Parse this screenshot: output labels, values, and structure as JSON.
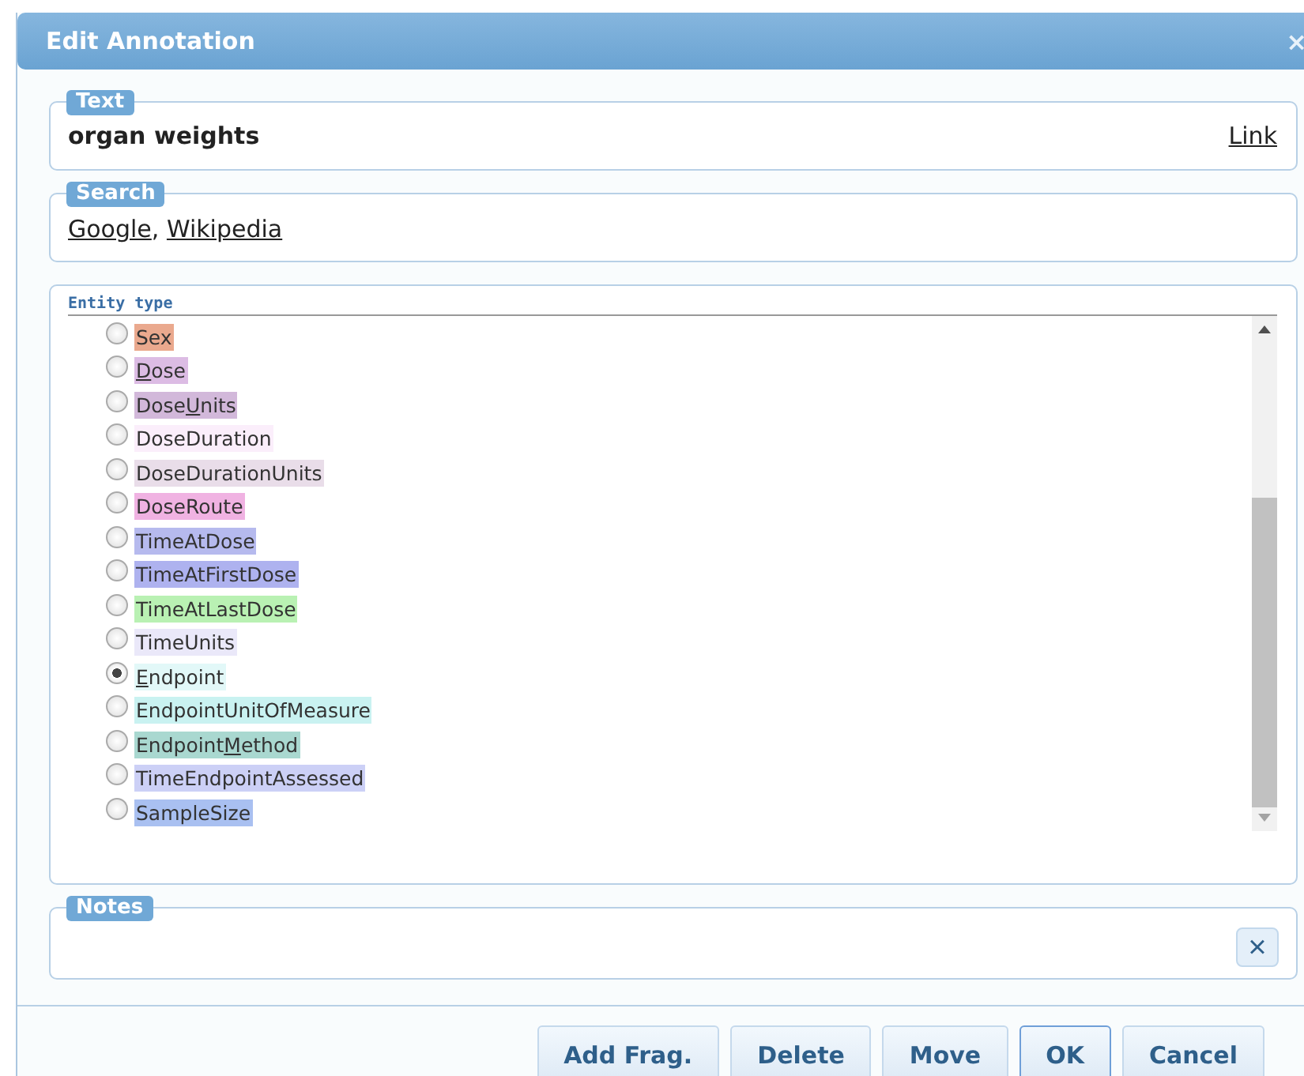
{
  "dialog": {
    "title": "Edit Annotation",
    "close": "×"
  },
  "text_section": {
    "legend": "Text",
    "value": "organ weights",
    "link": "Link"
  },
  "search_section": {
    "legend": "Search",
    "links": [
      "Google",
      "Wikipedia"
    ],
    "separator": ", "
  },
  "entity_section": {
    "legend": "Entity type",
    "options": [
      {
        "parts": [
          {
            "text": "Sex",
            "underlined": false
          }
        ],
        "color": "#eaa98e",
        "selected": false
      },
      {
        "parts": [
          {
            "text": "D",
            "underlined": true
          },
          {
            "text": "ose",
            "underlined": false
          }
        ],
        "color": "#dcbce4",
        "selected": false
      },
      {
        "parts": [
          {
            "text": "Dose",
            "underlined": false
          },
          {
            "text": "U",
            "underlined": true
          },
          {
            "text": "nits",
            "underlined": false
          }
        ],
        "color": "#d2b8da",
        "selected": false
      },
      {
        "parts": [
          {
            "text": "DoseDuration",
            "underlined": false
          }
        ],
        "color": "#fbeefb",
        "selected": false
      },
      {
        "parts": [
          {
            "text": "DoseDurationUnits",
            "underlined": false
          }
        ],
        "color": "#e9dde9",
        "selected": false
      },
      {
        "parts": [
          {
            "text": "DoseRoute",
            "underlined": false
          }
        ],
        "color": "#f0b2e2",
        "selected": false
      },
      {
        "parts": [
          {
            "text": "TimeAtDose",
            "underlined": false
          }
        ],
        "color": "#b6baee",
        "selected": false
      },
      {
        "parts": [
          {
            "text": "TimeAtFirstDose",
            "underlined": false
          }
        ],
        "color": "#aeb2ef",
        "selected": false
      },
      {
        "parts": [
          {
            "text": "TimeAtLastDose",
            "underlined": false
          }
        ],
        "color": "#b9f1b3",
        "selected": false
      },
      {
        "parts": [
          {
            "text": "TimeUnits",
            "underlined": false
          }
        ],
        "color": "#eae8f9",
        "selected": false
      },
      {
        "parts": [
          {
            "text": "E",
            "underlined": true
          },
          {
            "text": "ndpoint",
            "underlined": false
          }
        ],
        "color": "#e2f8f8",
        "selected": true
      },
      {
        "parts": [
          {
            "text": "EndpointUnitOfMeasure",
            "underlined": false
          }
        ],
        "color": "#c9f2f1",
        "selected": false
      },
      {
        "parts": [
          {
            "text": "Endpoint",
            "underlined": false
          },
          {
            "text": "M",
            "underlined": true
          },
          {
            "text": "ethod",
            "underlined": false
          }
        ],
        "color": "#a9d8d0",
        "selected": false
      },
      {
        "parts": [
          {
            "text": "TimeEndpointAssessed",
            "underlined": false
          }
        ],
        "color": "#ccd0f6",
        "selected": false
      },
      {
        "parts": [
          {
            "text": "SampleSize",
            "underlined": false
          }
        ],
        "color": "#a9c0f1",
        "selected": false
      }
    ]
  },
  "notes_section": {
    "legend": "Notes",
    "clear": "×"
  },
  "buttons": [
    {
      "label": "Add Frag.",
      "focused": false
    },
    {
      "label": "Delete",
      "focused": false
    },
    {
      "label": "Move",
      "focused": false
    },
    {
      "label": "OK",
      "focused": true
    },
    {
      "label": "Cancel",
      "focused": false
    }
  ]
}
